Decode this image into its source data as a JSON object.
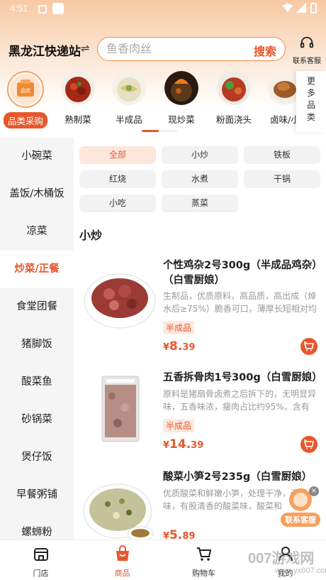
{
  "status_bar": {
    "time": "4:51"
  },
  "header": {
    "location": "黑龙江快递站",
    "search_placeholder": "鱼香肉丝",
    "search_button": "搜索",
    "service_label": "联系客服"
  },
  "categories": [
    {
      "label": "品类采购",
      "icon_text": "品类",
      "active": true
    },
    {
      "label": "熟制菜"
    },
    {
      "label": "半成品"
    },
    {
      "label": "现炒菜"
    },
    {
      "label": "粉面浇头"
    },
    {
      "label": "卤味/小"
    }
  ],
  "more_categories": [
    "更",
    "多",
    "品",
    "类"
  ],
  "sidebar": {
    "items": [
      "小碗菜",
      "盖饭/木桶饭",
      "凉菜",
      "炒菜/正餐",
      "食堂团餐",
      "猪脚饭",
      "酸菜鱼",
      "砂锅菜",
      "煲仔饭",
      "早餐粥铺",
      "螺蛳粉"
    ],
    "active_index": 3
  },
  "filters": [
    "全部",
    "小炒",
    "铁板",
    "红烧",
    "水煮",
    "干锅",
    "小吃",
    "蒸菜"
  ],
  "section_title": "小炒",
  "products": [
    {
      "title": "个性鸡杂2号300g（半成品鸡杂）（白雪厨娘）",
      "desc": "生制品，优质原料，高品质，高出成（焯水后≥75%）脆香可口，薄厚长短相对均",
      "badge": "半成品",
      "price_symbol": "¥",
      "price_int": "8.",
      "price_dec": "39"
    },
    {
      "title": "五香拆骨肉1号300g（白雪厨娘）",
      "desc": "原料是猪扇骨卤煮之后拆下的，无明显异味，五香味浓，瘦肉占比约95%，含有",
      "badge": "半成品",
      "price_symbol": "¥",
      "price_int": "14.",
      "price_dec": "39"
    },
    {
      "title": "酸菜小笋2号235g（白雪厨娘）",
      "desc": "优质酸菜和鲜嫩小笋，处理干净，无异味，有股清香的酸菜味，酸菜和",
      "badge": "",
      "price_symbol": "¥",
      "price_int": "5.",
      "price_dec": "89"
    }
  ],
  "float_service": {
    "label": "联系客服",
    "close": "×"
  },
  "bottom_nav": [
    {
      "label": "门店"
    },
    {
      "label": "商品",
      "active": true
    },
    {
      "label": "购物车"
    },
    {
      "label": "我的"
    }
  ],
  "watermark": {
    "main": "007游戏网",
    "sub": "www.yx007.com"
  },
  "colors": {
    "accent": "#e8572c",
    "search_border": "#f08a4b",
    "sidebar_bg": "#f5f5f5"
  }
}
